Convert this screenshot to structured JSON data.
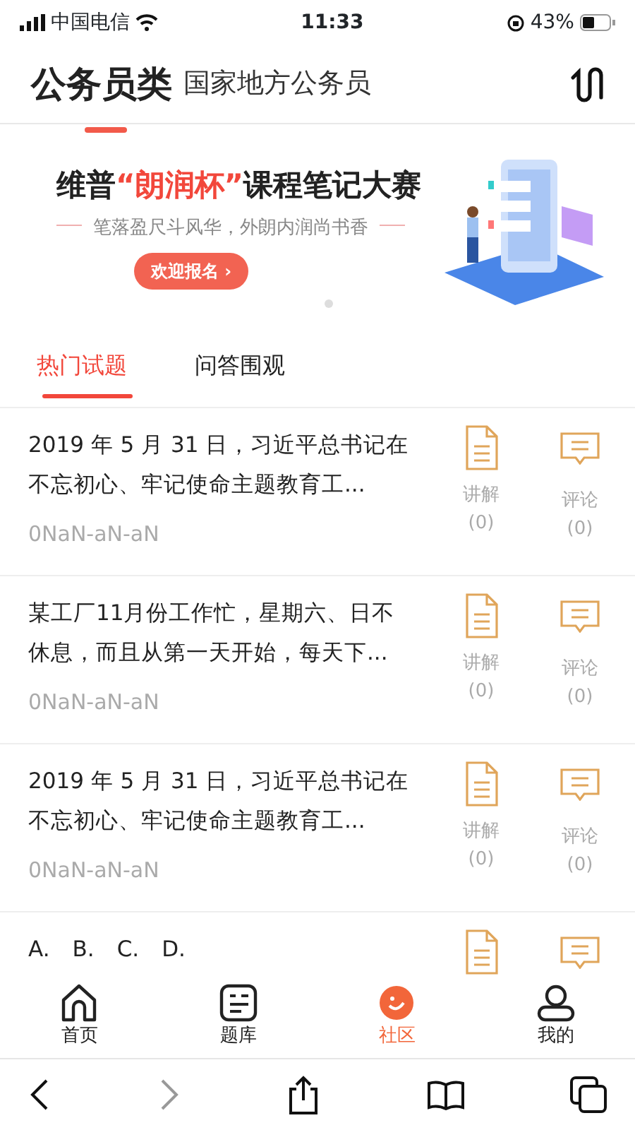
{
  "status_bar": {
    "carrier": "中国电信",
    "time": "11:33",
    "battery": "43%"
  },
  "header": {
    "title": "公务员类",
    "subtitle": "国家地方公务员"
  },
  "banner": {
    "title_parts": [
      {
        "text": "维普",
        "highlight": false
      },
      {
        "text": "“朗润杯”",
        "highlight": true
      },
      {
        "text": "课程笔记大赛",
        "highlight": false
      }
    ],
    "slogan": "笔落盈尺斗风华，外朗内润尚书香",
    "button": "欢迎报名 ›"
  },
  "tabs": [
    {
      "label": "热门试题",
      "selected": true
    },
    {
      "label": "问答围观",
      "selected": false
    }
  ],
  "questions": [
    {
      "text": "2019 年 5 月 31 日，习近平总书记在不忘初心、牢记使命主题教育工...",
      "date": "0NaN-aN-aN",
      "explain_label": "讲解",
      "explain_count": "(0)",
      "comment_label": "评论",
      "comment_count": "(0)"
    },
    {
      "text": "某工厂11月份工作忙，星期六、日不休息，而且从第一天开始，每天下...",
      "date": "0NaN-aN-aN",
      "explain_label": "讲解",
      "explain_count": "(0)",
      "comment_label": "评论",
      "comment_count": "(0)"
    },
    {
      "text": "2019 年 5 月 31 日，习近平总书记在不忘初心、牢记使命主题教育工...",
      "date": "0NaN-aN-aN",
      "explain_label": "讲解",
      "explain_count": "(0)",
      "comment_label": "评论",
      "comment_count": "(0)"
    },
    {
      "text": "A.　B.　C.　D."
    }
  ],
  "bottom_nav": [
    {
      "label": "首页",
      "selected": false
    },
    {
      "label": "题库",
      "selected": false
    },
    {
      "label": "社区",
      "selected": true
    },
    {
      "label": "我的",
      "selected": false
    }
  ],
  "browser_bar": {
    "forward_disabled": true
  }
}
